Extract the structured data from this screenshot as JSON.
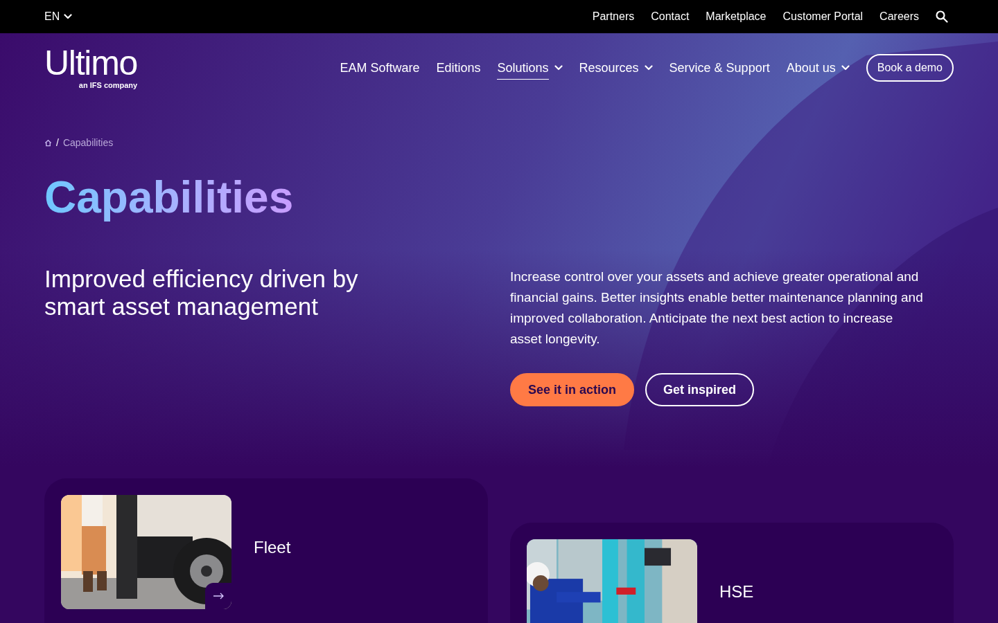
{
  "top_bar": {
    "language": "EN",
    "links": [
      "Partners",
      "Contact",
      "Marketplace",
      "Customer Portal",
      "Careers"
    ]
  },
  "header": {
    "logo": "Ultimo",
    "logo_tagline": "an IFS company",
    "nav": [
      {
        "label": "EAM Software",
        "has_menu": false,
        "selected": false
      },
      {
        "label": "Editions",
        "has_menu": false,
        "selected": false
      },
      {
        "label": "Solutions",
        "has_menu": true,
        "selected": true
      },
      {
        "label": "Resources",
        "has_menu": true,
        "selected": false
      },
      {
        "label": "Service & Support",
        "has_menu": false,
        "selected": false
      },
      {
        "label": "About us",
        "has_menu": true,
        "selected": false
      }
    ],
    "cta": "Book a demo"
  },
  "breadcrumb": {
    "separator": "/",
    "items": [
      "Capabilities"
    ]
  },
  "title": "Capabilities",
  "intro": {
    "heading": "Improved efficiency driven by smart asset management",
    "text": "Increase control over your assets and achieve greater operational and financial gains. Better insights enable better maintenance planning and improved collaboration. Anticipate the next best action to increase asset longevity.",
    "buttons": [
      {
        "label": "See it in action",
        "kind": "primary"
      },
      {
        "label": "Get inspired",
        "kind": "outline"
      }
    ]
  },
  "cards": [
    {
      "title": "Fleet"
    },
    {
      "title": "HSE"
    }
  ]
}
